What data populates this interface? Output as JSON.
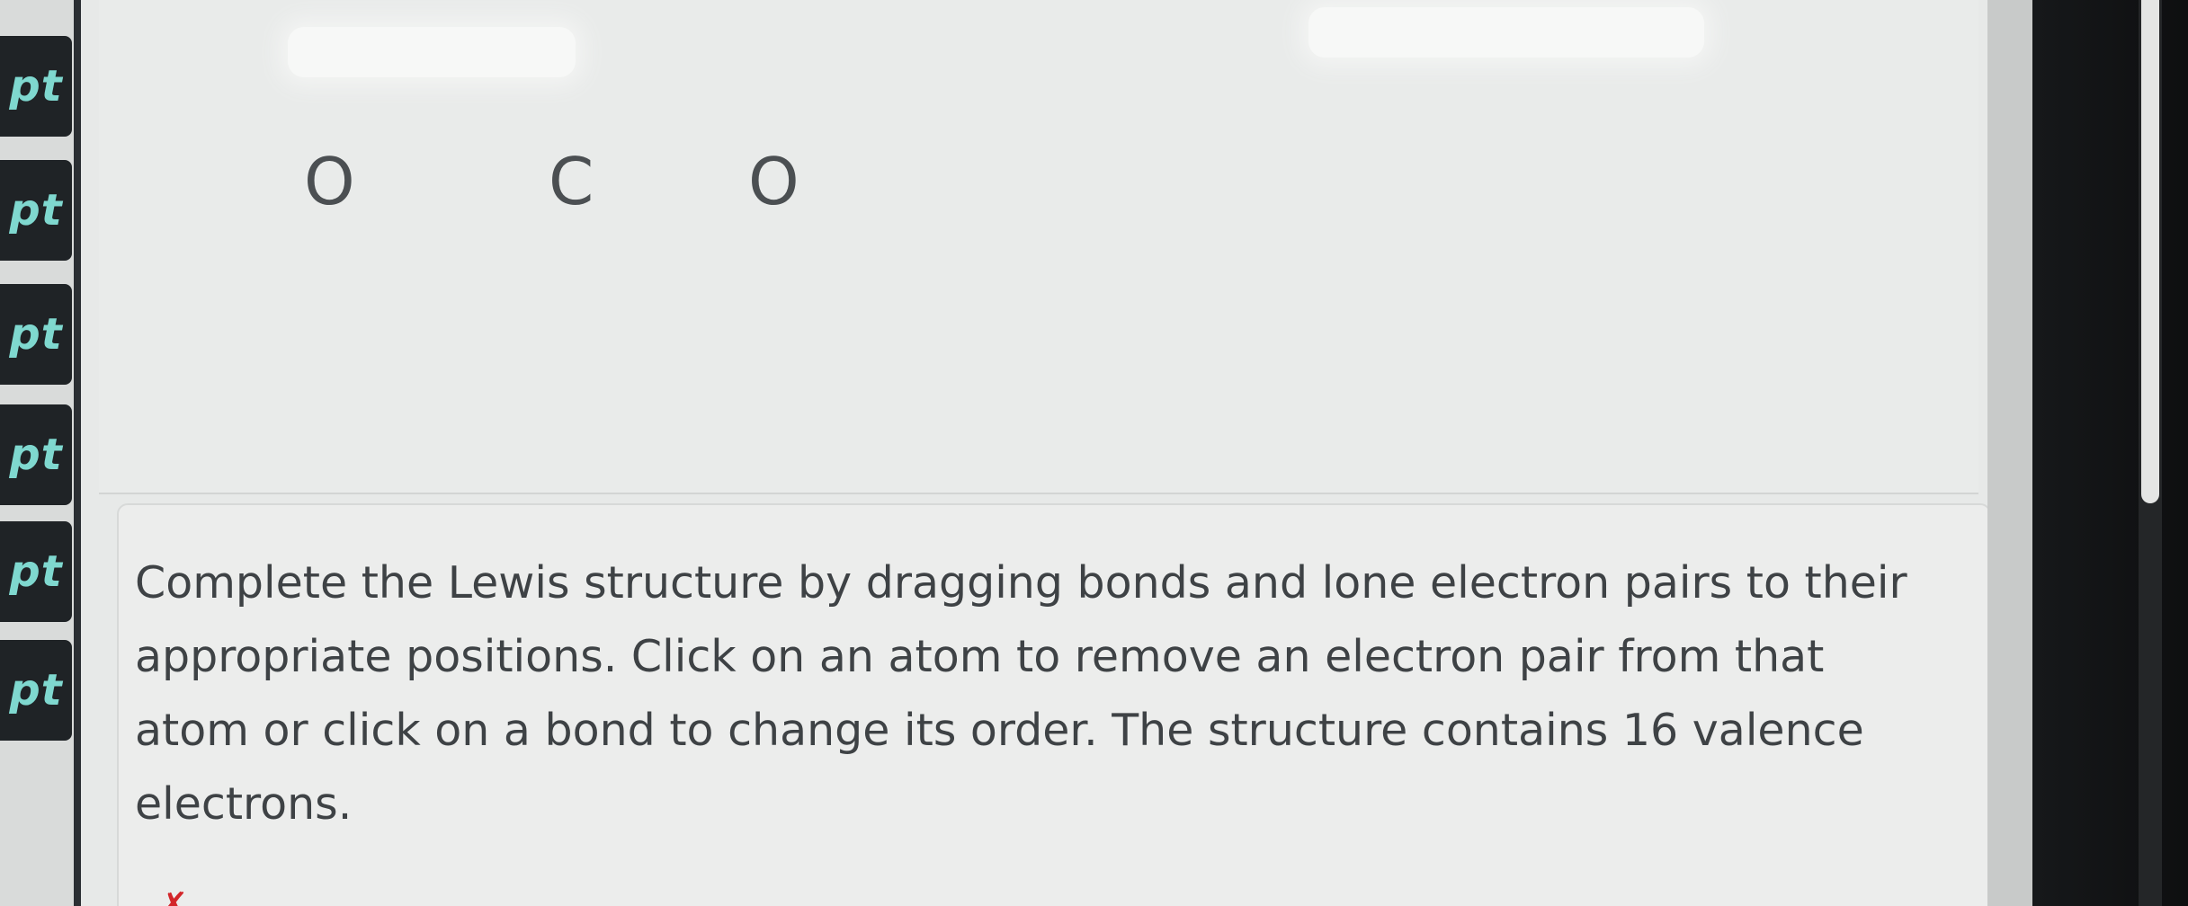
{
  "sidebar": {
    "tabs": [
      {
        "label": "pt"
      },
      {
        "label": "pt"
      },
      {
        "label": "pt"
      },
      {
        "label": "pt"
      },
      {
        "label": "pt"
      },
      {
        "label": "pt"
      }
    ]
  },
  "canvas": {
    "atoms": [
      {
        "symbol": "O"
      },
      {
        "symbol": "C"
      },
      {
        "symbol": "O"
      }
    ]
  },
  "question": {
    "instructions": "Complete the Lewis structure by dragging bonds and lone electron pairs to their appropriate positions. Click on an atom to remove an electron pair from that atom or click on a bond to change its order. The structure contains 16 valence electrons.",
    "status_mark": "✗"
  },
  "colors": {
    "tab_background": "#1f2326",
    "tab_text": "#7fd8cf",
    "atom_text": "#4b4f52",
    "body_text": "#3e4245",
    "error_mark": "#d3262a"
  }
}
